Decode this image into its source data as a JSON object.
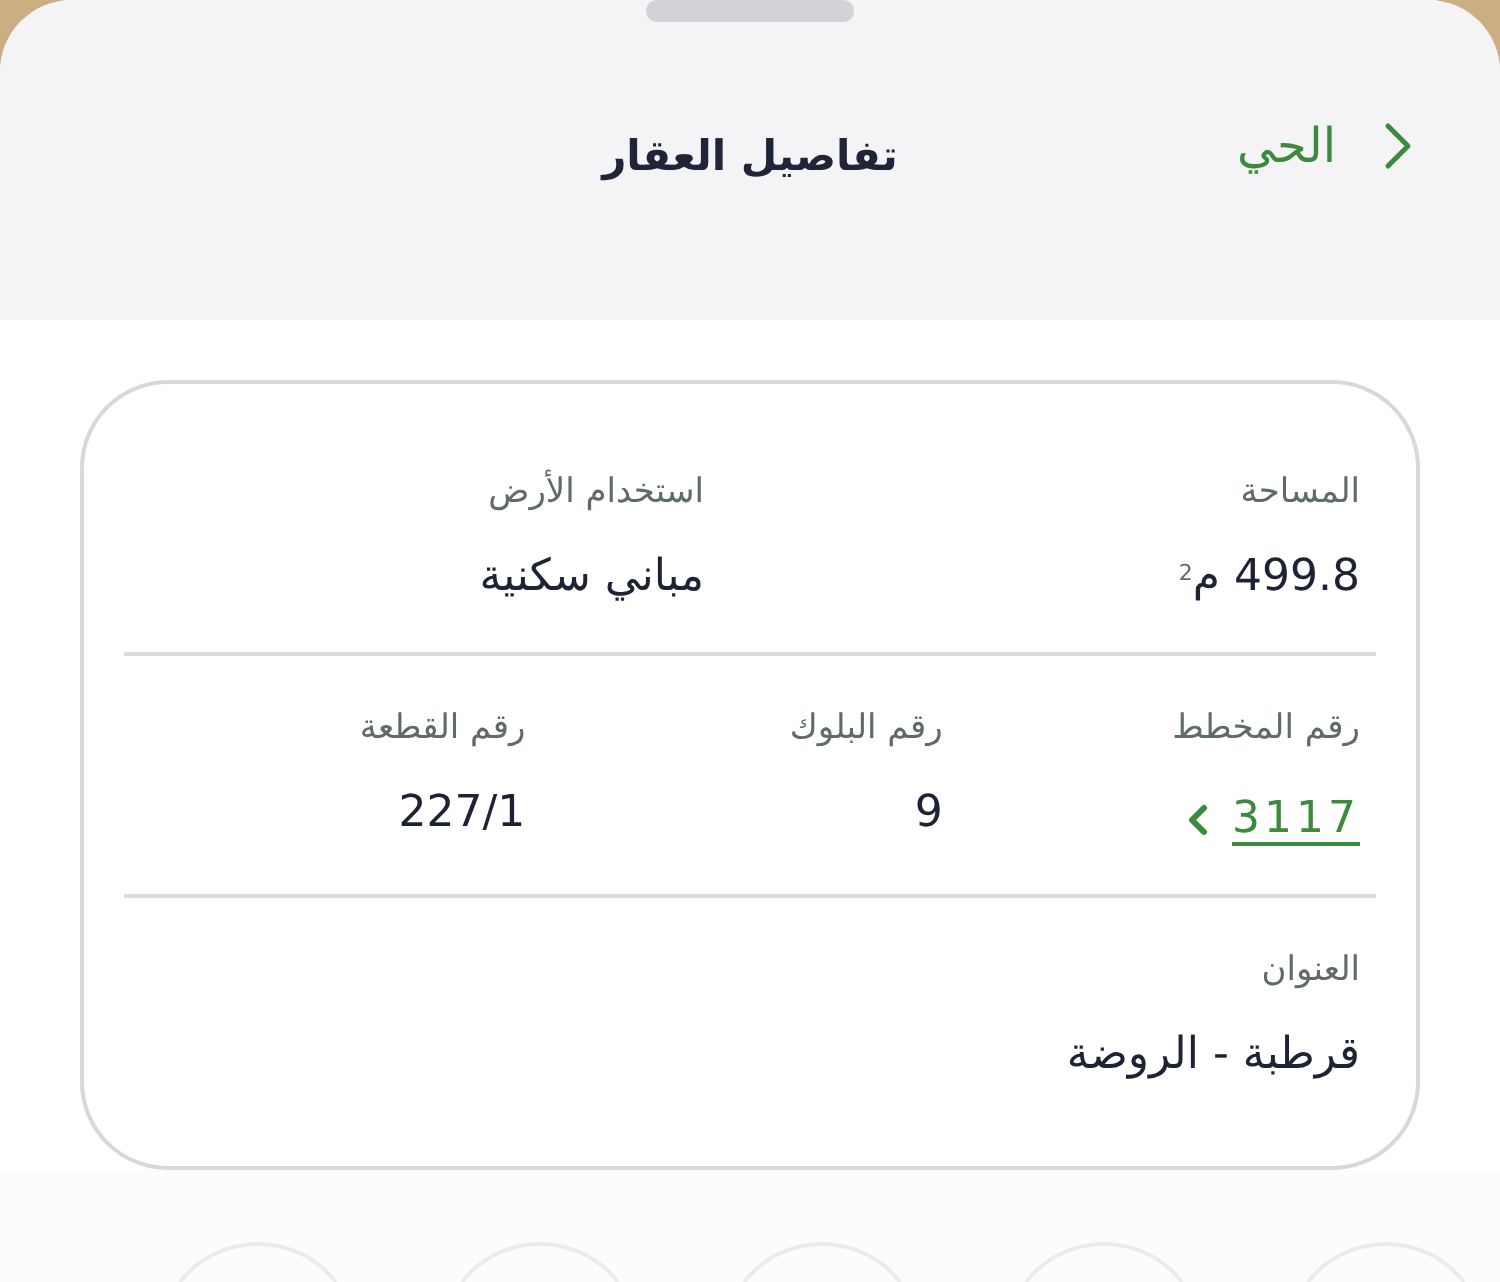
{
  "header": {
    "back_label": "الحي",
    "title": "تفاصيل العقار"
  },
  "details_card": {
    "rows": [
      {
        "fields": [
          {
            "label": "المساحة",
            "value": "499.8 م$^{2}$",
            "kind": "text"
          },
          {
            "label": "استخدام الأرض",
            "value": "مباني سكنية",
            "kind": "text"
          }
        ]
      },
      {
        "fields": [
          {
            "label": "رقم المخطط",
            "value": "3117",
            "kind": "link"
          },
          {
            "label": "رقم البلوك",
            "value": "9",
            "kind": "text"
          },
          {
            "label": "رقم القطعة",
            "value": "227/1",
            "kind": "text"
          }
        ]
      },
      {
        "fields": [
          {
            "label": "العنوان",
            "value": "قرطبة - الروضة",
            "kind": "text"
          }
        ]
      }
    ]
  }
}
